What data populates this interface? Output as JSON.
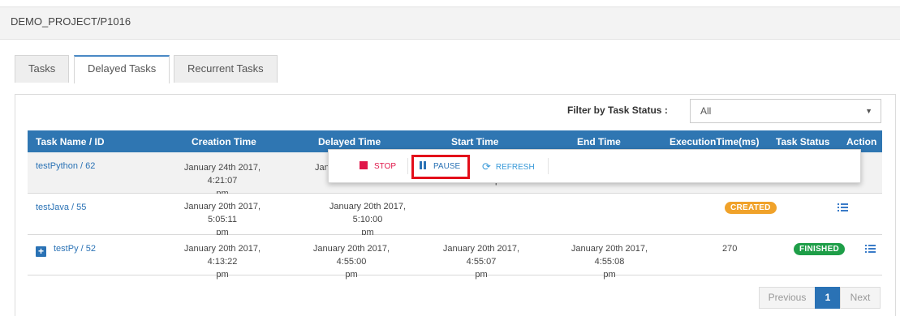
{
  "breadcrumb": "DEMO_PROJECT/P1016",
  "tabs": [
    {
      "label": "Tasks",
      "active": false
    },
    {
      "label": "Delayed Tasks",
      "active": true
    },
    {
      "label": "Recurrent Tasks",
      "active": false
    }
  ],
  "filter": {
    "label": "Filter by Task Status :",
    "selected": "All"
  },
  "table": {
    "headers": [
      "Task Name / ID",
      "Creation Time",
      "Delayed Time",
      "Start Time",
      "End Time",
      "ExecutionTime(ms)",
      "Task Status",
      "Action"
    ],
    "rows": [
      {
        "name": "testPython / 62",
        "creation": [
          "January 24th 2017, 4:21:07",
          "pm"
        ],
        "delayed_partial": "Jan",
        "start_partial": "pm",
        "end": [
          "",
          ""
        ],
        "exec": "",
        "status": ""
      },
      {
        "name": "testJava / 55",
        "creation": [
          "January 20th 2017, 5:05:11",
          "pm"
        ],
        "delayed": [
          "January 20th 2017, 5:10:00",
          "pm"
        ],
        "start": [
          "",
          ""
        ],
        "end": [
          "",
          ""
        ],
        "exec": "",
        "status": "CREATED"
      },
      {
        "name": "testPy / 52",
        "creation": [
          "January 20th 2017, 4:13:22",
          "pm"
        ],
        "delayed": [
          "January 20th 2017, 4:55:00",
          "pm"
        ],
        "start": [
          "January 20th 2017, 4:55:07",
          "pm"
        ],
        "end": [
          "January 20th 2017, 4:55:08",
          "pm"
        ],
        "exec": "270",
        "status": "FINISHED"
      }
    ]
  },
  "popup": {
    "stop": "STOP",
    "pause": "PAUSE",
    "refresh": "REFRESH"
  },
  "pagination": {
    "previous": "Previous",
    "current": "1",
    "next": "Next"
  },
  "colors": {
    "header": "#2f76b2",
    "link": "#2a72b5",
    "created": "#f0a22a",
    "finished": "#1e9e48",
    "stop": "#e0174a",
    "highlight": "#e30e1a"
  }
}
